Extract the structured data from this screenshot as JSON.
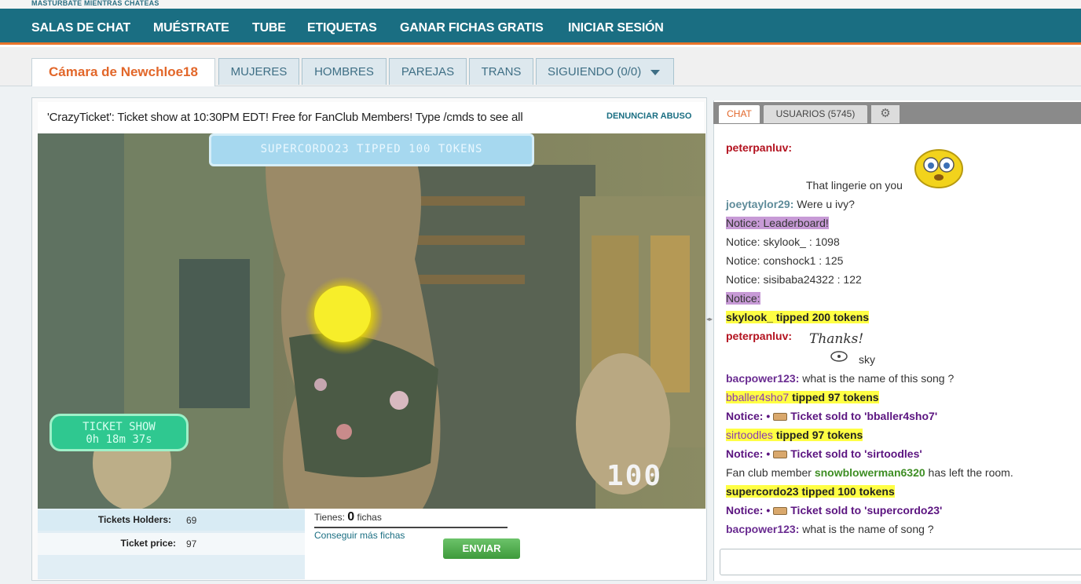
{
  "header": {
    "tagline": "MASTURBATE MIENTRAS CHATEAS",
    "nav": [
      "SALAS DE CHAT",
      "MUÉSTRATE",
      "TUBE",
      "ETIQUETAS",
      "GANAR FICHAS GRATIS",
      "INICIAR SESIÓN"
    ]
  },
  "tabs": {
    "active": "Cámara de Newchloe18",
    "items": [
      "MUJERES",
      "HOMBRES",
      "PAREJAS",
      "TRANS",
      "SIGUIENDO (0/0)"
    ]
  },
  "room": {
    "subject": "'CrazyTicket': Ticket show at 10:30PM EDT! Free for FanClub Members! Type /cmds to see all",
    "report_label": "DENUNCIAR ABUSO"
  },
  "video": {
    "tip_banner": "SUPERCORDO23 TIPPED 100 TOKENS",
    "ticket_show_title": "TICKET SHOW",
    "ticket_show_timer": "0h 18m 37s",
    "tip_counter": "100"
  },
  "ticket_info": {
    "holders_label": "Tickets Holders:",
    "holders_value": "69",
    "price_label": "Ticket price:",
    "price_value": "97"
  },
  "tokens": {
    "have_prefix": "Tienes:",
    "have_amount": "0",
    "have_suffix": "fichas",
    "get_more": "Conseguir más fichas",
    "send_label": "ENVIAR"
  },
  "chat": {
    "tab_chat": "CHAT",
    "tab_users": "USUARIOS (5745)",
    "messages": {
      "m1_user": "peterpanluv:",
      "m1_text": "That lingerie on you",
      "m2_user": "joeytaylor29:",
      "m2_text": "Were u ivy?",
      "m3_text": "Notice: Leaderboard!",
      "m4_text": "Notice: skylook_ : 1098",
      "m5_text": "Notice: conshock1 : 125",
      "m6_text": "Notice: sisibaba24322 : 122",
      "m7_text": "Notice:",
      "m8_text": "skylook_ tipped 200 tokens",
      "m9_user": "peterpanluv:",
      "m9_image_text": "Thanks!",
      "m9_caption": "sky",
      "m10_user": "bacpower123:",
      "m10_text": "what is the name of this song ?",
      "m11_user": "bballer4sho7",
      "m11_text": "tipped 97 tokens",
      "m12_prefix": "Notice: •",
      "m12_text": "Ticket sold to 'bballer4sho7'",
      "m13_user": "sirtoodles",
      "m13_text": "tipped 97 tokens",
      "m14_prefix": "Notice: •",
      "m14_text": "Ticket sold to 'sirtoodles'",
      "m15_pre": "Fan club member",
      "m15_user": "snowblowerman6320",
      "m15_post": "has left the room.",
      "m16_text": "supercordo23 tipped 100 tokens",
      "m17_prefix": "Notice: •",
      "m17_text": "Ticket sold to 'supercordo23'",
      "m18_user": "bacpower123:",
      "m18_text": "what is the name of song ?"
    }
  },
  "colors": {
    "nav_bg": "#1a6e82",
    "accent_orange": "#e2672a",
    "tip_highlight": "#ffff44",
    "notice_purple": "#6a2c91"
  }
}
